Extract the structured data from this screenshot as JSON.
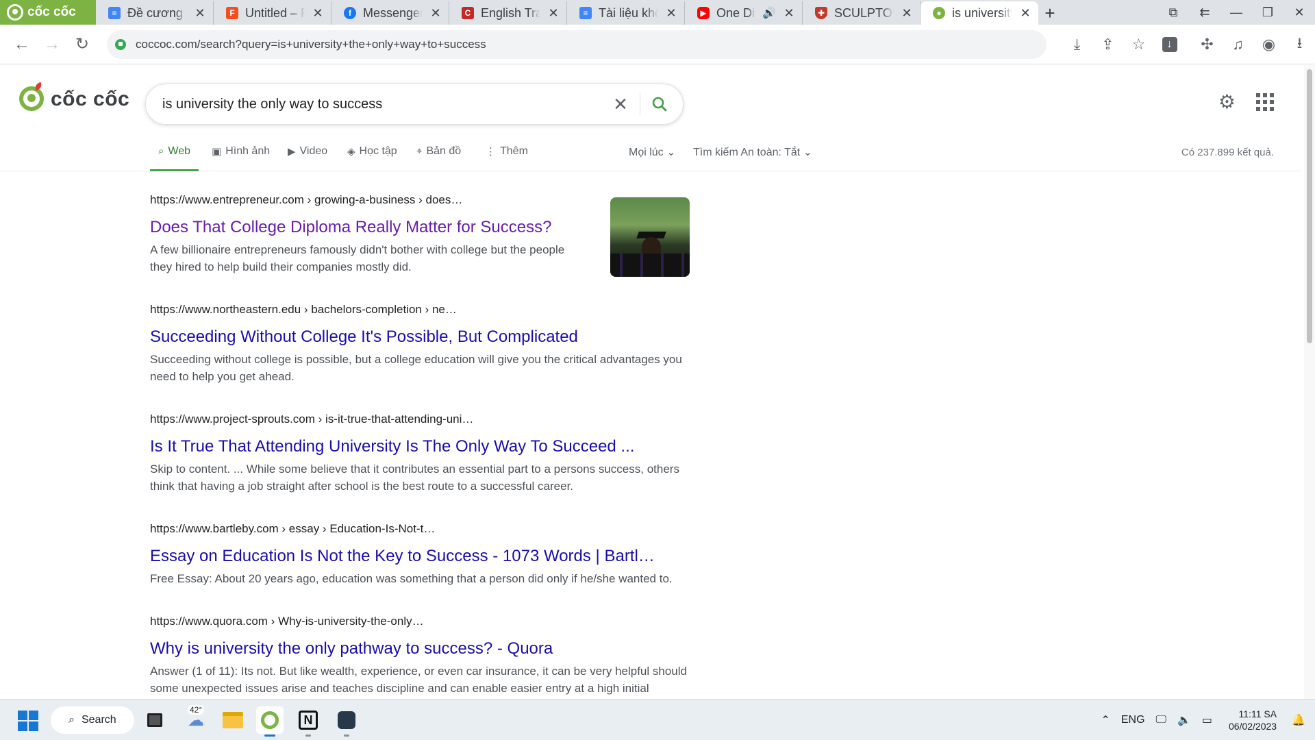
{
  "browser": {
    "brand_label": "cốc cốc",
    "tabs": [
      {
        "title": "Đề cương Ng",
        "favicon": "docs-icon",
        "color": "#4285f4"
      },
      {
        "title": "Untitled – Figma",
        "favicon": "figma-icon",
        "color": "#f24e1e"
      },
      {
        "title": "Messenger | Facebook",
        "favicon": "facebook-icon",
        "color": "#1877f2"
      },
      {
        "title": "English Translation",
        "favicon": "dictionary-icon",
        "color": "#c62828"
      },
      {
        "title": "Tài liệu không có tiêu đề",
        "favicon": "docs-icon",
        "color": "#4285f4"
      },
      {
        "title": "One Direction",
        "favicon": "youtube-icon",
        "color": "#ff0000"
      },
      {
        "title": "SCULPTOR |",
        "favicon": "shield-icon",
        "color": "#c0392b"
      },
      {
        "title": "is university the only way",
        "favicon": "coccoc-icon",
        "color": "#7cb342"
      }
    ],
    "address_url": "coccoc.com/search?query=is+university+the+only+way+to+success"
  },
  "search": {
    "logo_text": "cốc cốc",
    "query": "is university the only way to success",
    "filters": {
      "web": "Web",
      "images": "Hình ảnh",
      "video": "Video",
      "study": "Học tập",
      "maps": "Bản đồ",
      "more": "Thêm",
      "time": "Mọi lúc",
      "safe_search": "Tìm kiếm An toàn: Tắt"
    },
    "result_count": "Có 237.899 kết quả."
  },
  "results": [
    {
      "url": "https://www.entrepreneur.com › growing-a-business › does…",
      "title": "Does That College Diploma Really Matter for Success?",
      "snippet": "A few billionaire entrepreneurs famously didn't bother with college but the people they hired to help build their companies mostly did."
    },
    {
      "url": "https://www.northeastern.edu › bachelors-completion › ne…",
      "title": "Succeeding Without College It's Possible, But Complicated",
      "snippet": "Succeeding without college is possible, but a college education will give you the critical advantages you need to help you get ahead."
    },
    {
      "url": "https://www.project-sprouts.com › is-it-true-that-attending-uni…",
      "title": "Is It True That Attending University Is The Only Way To Succeed ...",
      "snippet": "Skip to content. ... While some believe that it contributes an essential part to a persons success, others think that having a job straight after school is the best route to a successful career."
    },
    {
      "url": "https://www.bartleby.com › essay › Education-Is-Not-t…",
      "title": "Essay on Education Is Not the Key to Success - 1073 Words | Bartl…",
      "snippet": "Free Essay: About 20 years ago, education was something that a person did only if he/she wanted to."
    },
    {
      "url": "https://www.quora.com › Why-is-university-the-only…",
      "title": "Why is university the only pathway to success? - Quora",
      "snippet": "Answer (1 of 11): Its not. But like wealth, experience, or even car insurance, it can be very helpful should some unexpected issues arise and teaches discipline and can enable easier entry at a high initial"
    }
  ],
  "taskbar": {
    "search_label": "Search",
    "weather_temp": "42°",
    "language": "ENG",
    "time": "11:11 SA",
    "date": "06/02/2023"
  },
  "colors": {
    "brand_green": "#7cb342",
    "link_blue": "#1a0dab",
    "link_visited": "#681da8",
    "active_tab_green": "#43a047"
  }
}
